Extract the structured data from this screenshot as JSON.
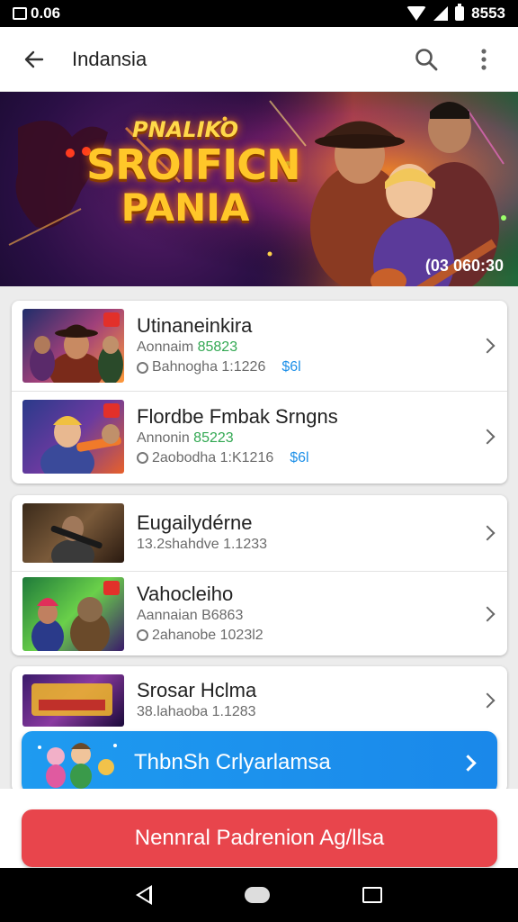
{
  "status_bar": {
    "time_left": "0.06",
    "time_right": "8553"
  },
  "app_bar": {
    "title": "Indansia"
  },
  "banner": {
    "sub": "PNALIKO",
    "main_1": "SROIFICN",
    "main_2": "PANIA",
    "overlay": "(03 060:30"
  },
  "list": {
    "cards": [
      {
        "rows": [
          {
            "title": "Utinaneinkira",
            "meta_label": "Aonnaim",
            "meta_value": "85823",
            "foot": "Bahnogha 1:1226",
            "foot_blue": "$6l"
          },
          {
            "title": "Flordbe Fmbak Srngns",
            "meta_label": "Annonin",
            "meta_value": "85223",
            "foot": "2aobodha 1:K1216",
            "foot_blue": "$6l"
          }
        ]
      },
      {
        "rows": [
          {
            "title": "Eugailydérne",
            "foot_plain": "13.2shahdve 1.1233"
          },
          {
            "title": "Vahocleiho",
            "meta_label": "Aannaian",
            "meta_value": "B6863",
            "foot": "2ahanobe 1023l2"
          }
        ]
      },
      {
        "rows": [
          {
            "title": "Srosar Hclma",
            "foot_plain": "38.lahaoba 1.1283"
          }
        ]
      }
    ]
  },
  "promo": {
    "label": "ThbnSh Crlyarlamsa"
  },
  "primary_action": {
    "label": "Nennral Padrenion Ag/llsa"
  },
  "colors": {
    "accent_blue": "#1e90e8",
    "action_red": "#e8454c",
    "meta_green": "#32a852"
  },
  "icons": [
    "photo-icon",
    "wifi-icon",
    "signal-icon",
    "battery-icon",
    "back-arrow-icon",
    "search-icon",
    "more-vert-icon",
    "clock-icon",
    "chevron-right-icon",
    "nav-back-icon",
    "nav-home-icon",
    "nav-recents-icon"
  ]
}
